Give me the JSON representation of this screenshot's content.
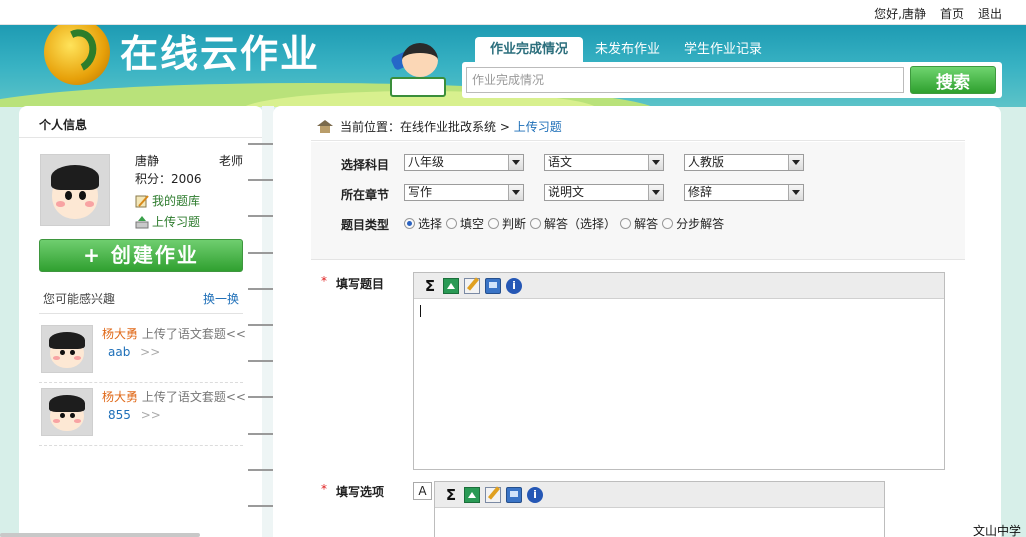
{
  "topbar": {
    "greeting": "您好,唐静",
    "home": "首页",
    "logout": "退出"
  },
  "header": {
    "logo_text": "在线云作业",
    "tabs": [
      {
        "label": "作业完成情况",
        "active": true
      },
      {
        "label": "未发布作业",
        "active": false
      },
      {
        "label": "学生作业记录",
        "active": false
      }
    ],
    "search": {
      "placeholder": "作业完成情况",
      "button": "搜索"
    }
  },
  "sidebar": {
    "title": "个人信息",
    "profile": {
      "name": "唐静",
      "role": "老师",
      "score": "积分：2006",
      "links": [
        "我的题库",
        "上传习题"
      ]
    },
    "create_button": "+ 创建作业",
    "interest": {
      "title": "您可能感兴趣",
      "refresh": "换一换",
      "items": [
        {
          "user": "杨大勇",
          "action": "上传了语文套题<<",
          "code": "aab",
          "more": ">>"
        },
        {
          "user": "杨大勇",
          "action": "上传了语文套题<<",
          "code": "855",
          "more": ">>"
        }
      ]
    }
  },
  "main": {
    "breadcrumb": {
      "prefix": "当前位置：",
      "system": "在线作业批改系统",
      "sep": ">",
      "current": "上传习题"
    },
    "filters": {
      "subject_label": "选择科目",
      "subject": [
        "八年级",
        "语文",
        "人教版"
      ],
      "chapter_label": "所在章节",
      "chapter": [
        "写作",
        "说明文",
        "修辞"
      ],
      "type_label": "题目类型",
      "types": [
        {
          "label": "选择",
          "selected": true
        },
        {
          "label": "填空",
          "selected": false
        },
        {
          "label": "判断",
          "selected": false
        },
        {
          "label": "解答（选择）",
          "selected": false
        },
        {
          "label": "解答",
          "selected": false
        },
        {
          "label": "分步解答",
          "selected": false
        }
      ]
    },
    "question_label": "填写题目",
    "option_label": "填写选项",
    "option_letter": "A",
    "required_mark": "*"
  },
  "footer": {
    "school": "文山中学"
  },
  "colors": {
    "accent_green": "#2ea02e",
    "header_teal": "#1e9bb3",
    "link_blue": "#1e6fb8",
    "user_orange": "#e06a1a"
  }
}
